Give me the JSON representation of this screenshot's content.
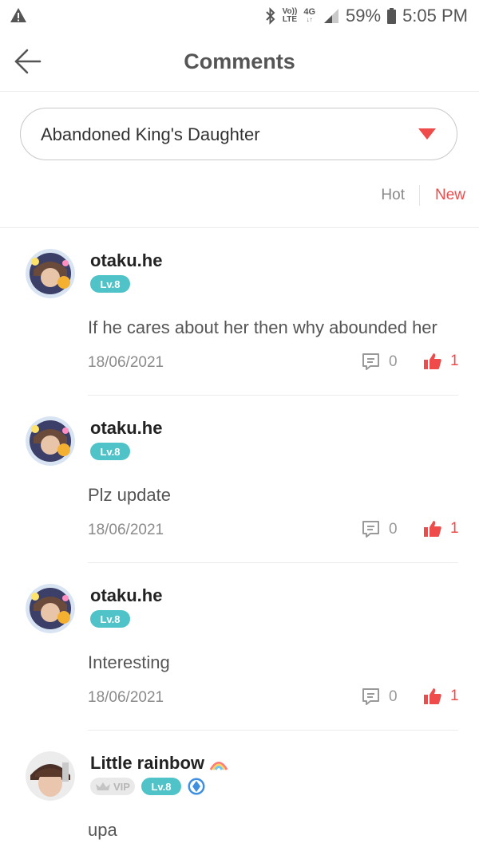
{
  "status_bar": {
    "warning_icon": "warning-icon",
    "bluetooth_icon": "bluetooth-icon",
    "volte_top": "Vo))",
    "volte_bottom": "LTE",
    "network": "4G",
    "battery": "59%",
    "time": "5:05 PM"
  },
  "header": {
    "title": "Comments",
    "back_icon": "arrow-left-icon"
  },
  "book_select": {
    "value": "Abandoned King's Daughter"
  },
  "sort": {
    "hot": "Hot",
    "new": "New",
    "active": "New"
  },
  "colors": {
    "accent": "#f04b4b",
    "level_badge": "#4fc3c8"
  },
  "comments": [
    {
      "username": "otaku.he",
      "level": "Lv.8",
      "text": "If he cares about her then why abounded her",
      "date": "18/06/2021",
      "replies": "0",
      "likes": "1"
    },
    {
      "username": "otaku.he",
      "level": "Lv.8",
      "text": "Plz update",
      "date": "18/06/2021",
      "replies": "0",
      "likes": "1"
    },
    {
      "username": "otaku.he",
      "level": "Lv.8",
      "text": "Interesting",
      "date": "18/06/2021",
      "replies": "0",
      "likes": "1"
    },
    {
      "username": "Little rainbow",
      "vip": "VIP",
      "level": "Lv.8",
      "text": "upa"
    }
  ]
}
